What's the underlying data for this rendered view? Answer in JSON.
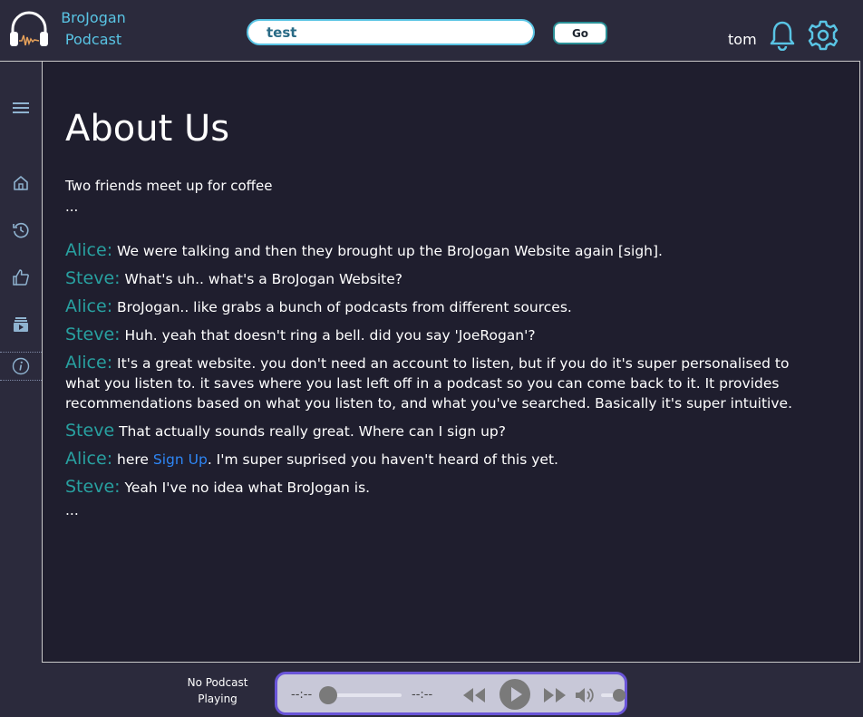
{
  "header": {
    "brand_line1": "BroJogan",
    "brand_line2": "Podcast",
    "search_value": "test",
    "go_label": "Go",
    "username": "tom"
  },
  "sidebar": {
    "items": [
      {
        "icon": "menu-icon"
      },
      {
        "icon": "home-icon"
      },
      {
        "icon": "history-icon"
      },
      {
        "icon": "thumbs-up-icon"
      },
      {
        "icon": "subscriptions-icon"
      },
      {
        "icon": "info-icon",
        "active": true
      }
    ]
  },
  "main": {
    "title": "About Us",
    "intro": "Two friends meet up for coffee",
    "ellipsis": "...",
    "dialogue": [
      {
        "speaker": "Alice:",
        "text": "We were talking and then they brought up the BroJogan Website again [sigh]."
      },
      {
        "speaker": "Steve:",
        "text": "What's uh.. what's a BroJogan Website?"
      },
      {
        "speaker": "Alice:",
        "text": "BroJogan.. like grabs a bunch of podcasts from different sources."
      },
      {
        "speaker": "Steve:",
        "text": "Huh. yeah that doesn't ring a bell. did you say 'JoeRogan'?"
      },
      {
        "speaker": "Alice:",
        "text": "It's a great website. you don't need an account to listen, but if you do it's super personalised to what you listen to. it saves where you last left off in a podcast so you can come back to it. It provides recommendations based on what you listen to, and what you've searched. Basically it's super intuitive."
      },
      {
        "speaker": "Steve",
        "text": "That actually sounds really great. Where can I sign up?"
      },
      {
        "speaker": "Alice:",
        "text_before": "here",
        "link": "Sign Up",
        "text_after": ". I'm super suprised you haven't heard of this yet."
      },
      {
        "speaker": "Steve:",
        "text": "Yeah I've no idea what BroJogan is."
      }
    ],
    "ending": "..."
  },
  "player": {
    "now_playing_line1": "No Podcast",
    "now_playing_line2": "Playing",
    "time_current": "--:--",
    "time_total": "--:--",
    "seek_progress": 0,
    "volume_level": 1
  },
  "colors": {
    "accent": "#59c4e4",
    "speaker": "#28a0a0",
    "link": "#2e86f5",
    "player_border": "#6a55d8"
  }
}
